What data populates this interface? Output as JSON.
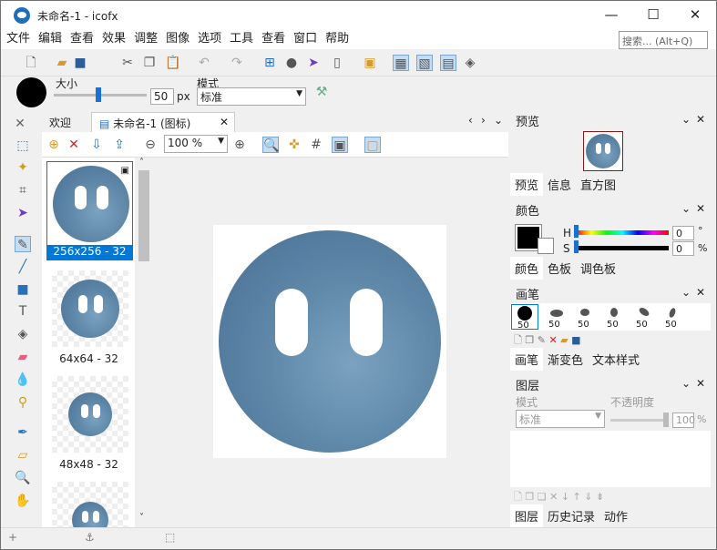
{
  "window": {
    "title": "未命名-1 - icofx",
    "controls": [
      "—",
      "☐",
      "✕"
    ]
  },
  "menu": [
    "文件",
    "编辑",
    "查看",
    "效果",
    "调整",
    "图像",
    "选项",
    "工具",
    "查看",
    "窗口",
    "帮助"
  ],
  "search": {
    "placeholder": "搜索... (Alt+Q)"
  },
  "brushbar": {
    "size_label": "大小",
    "size_value": "50",
    "size_unit": "px",
    "mode_label": "模式",
    "mode_value": "标准"
  },
  "tabs": {
    "welcome": "欢迎",
    "document": "未命名-1 (图标)"
  },
  "canvas_toolbar": {
    "zoom": "100 %"
  },
  "thumbnails": [
    {
      "label": "256x256 - 32"
    },
    {
      "label": "64x64 - 32"
    },
    {
      "label": "48x48 - 32"
    }
  ],
  "panels": {
    "preview": {
      "title": "预览",
      "tabs": [
        "预览",
        "信息",
        "直方图"
      ]
    },
    "color": {
      "title": "颜色",
      "h_label": "H",
      "h_value": "0",
      "h_unit": "°",
      "s_label": "S",
      "s_value": "0",
      "s_unit": "%",
      "tabs": [
        "颜色",
        "色板",
        "调色板"
      ]
    },
    "brush": {
      "title": "画笔",
      "sizes": [
        "50",
        "50",
        "50",
        "50",
        "50",
        "50"
      ],
      "tabs": [
        "画笔",
        "渐变色",
        "文本样式"
      ]
    },
    "layers": {
      "title": "图层",
      "mode_label": "模式",
      "mode_value": "标准",
      "opacity_label": "不透明度",
      "opacity_value": "100",
      "opacity_unit": "%",
      "tabs": [
        "图层",
        "历史记录",
        "动作"
      ]
    }
  },
  "colors": {
    "accent": "#1f6fb8",
    "selection": "#0078d7",
    "foreground": "#000000"
  }
}
